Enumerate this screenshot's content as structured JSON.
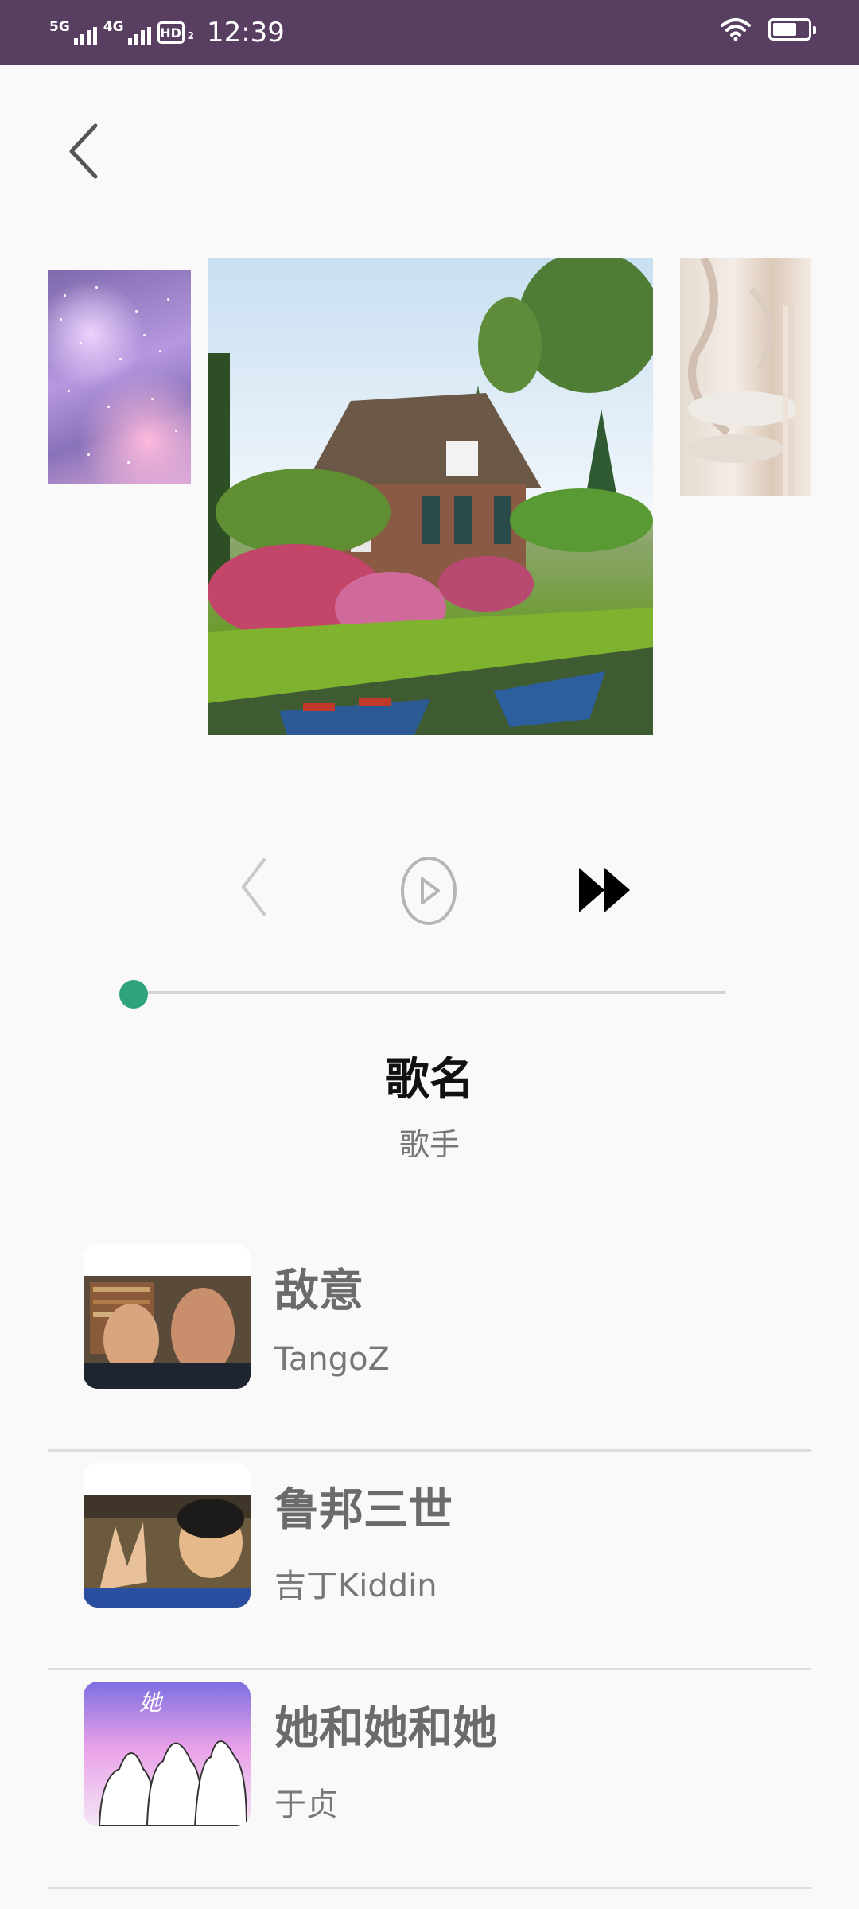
{
  "status_bar": {
    "network_1": "5G",
    "network_2": "4G",
    "hd": "HD",
    "hd_sub": "2",
    "time": "12:39",
    "battery_level": 0.7
  },
  "player": {
    "song_name": "歌名",
    "artist": "歌手",
    "progress": 0.0,
    "accent_color": "#2fa37d"
  },
  "playlist": [
    {
      "title": "敌意",
      "artist": "TangoZ"
    },
    {
      "title": "鲁邦三世",
      "artist": "吉丁Kiddin"
    },
    {
      "title": "她和她和她",
      "artist": "于贞",
      "art_text": "她"
    }
  ]
}
